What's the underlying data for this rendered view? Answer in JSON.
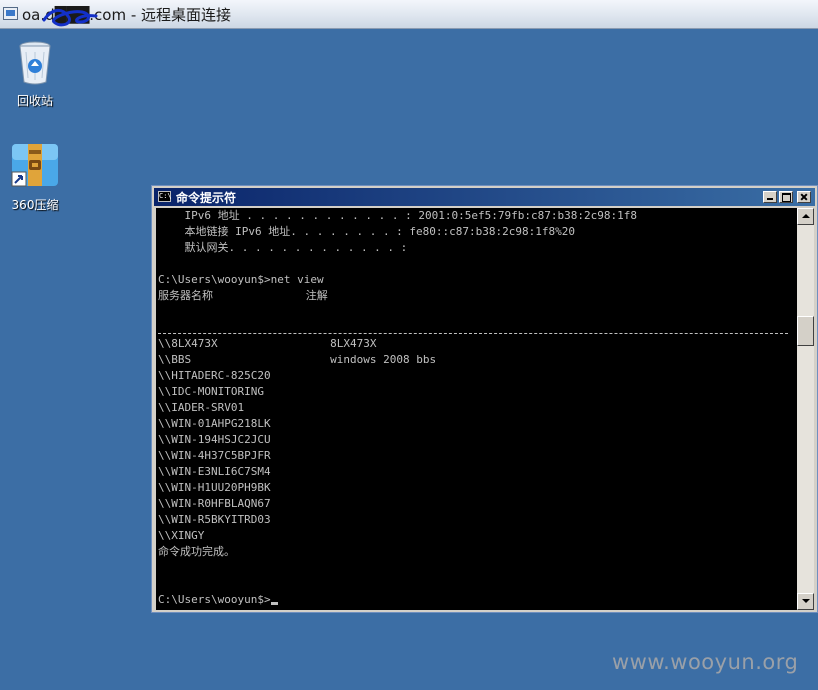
{
  "rdp": {
    "title": "oa.d███.com - 远程桌面连接"
  },
  "desktop": {
    "icons": [
      {
        "label": "回收站",
        "icon": "recycle-bin-icon"
      },
      {
        "label": "360压缩",
        "icon": "archive-icon"
      }
    ]
  },
  "cmd": {
    "title": "命令提示符",
    "icon_text": "C:\\",
    "lines": [
      "    IPv6 地址 . . . . . . . . . . . . : 2001:0:5ef5:79fb:c87:b38:2c98:1f8",
      "    本地链接 IPv6 地址. . . . . . . . : fe80::c87:b38:2c98:1f8%20",
      "    默认网关. . . . . . . . . . . . . :",
      "",
      "C:\\Users\\wooyun$>net view",
      "服务器名称              注解",
      "",
      "",
      "\\\\8LX473X                 8LX473X",
      "\\\\BBS                     windows 2008 bbs",
      "\\\\HITADERC-825C20",
      "\\\\IDC-MONITORING",
      "\\\\IADER-SRV01",
      "\\\\WIN-01AHPG218LK",
      "\\\\WIN-194HSJC2JCU",
      "\\\\WIN-4H37C5BPJFR",
      "\\\\WIN-E3NLI6C7SM4",
      "\\\\WIN-H1UU20PH9BK",
      "\\\\WIN-R0HFBLAQN67",
      "\\\\WIN-R5BKYITRD03",
      "\\\\XINGY",
      "命令成功完成。",
      "",
      "",
      ""
    ],
    "prompt": "C:\\Users\\wooyun$>"
  },
  "watermark": "www.wooyun.org",
  "colors": {
    "desktop": "#3c6ea5",
    "console_bg": "#000000",
    "console_fg": "#c0c0c0",
    "titlebar": "#0a246a"
  }
}
